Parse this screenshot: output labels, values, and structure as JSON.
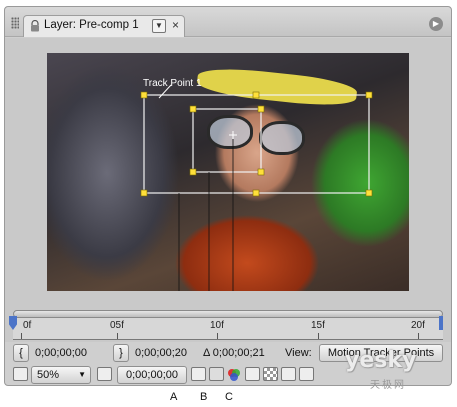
{
  "tab": {
    "title": "Layer: Pre-comp 1",
    "dropdown_glyph": "▼",
    "close_glyph": "×"
  },
  "panel_menu_glyph": "▶",
  "viewer": {
    "track_point_label": "Track Point 1"
  },
  "timeline": {
    "ticks": [
      "0f",
      "05f",
      "10f",
      "15f",
      "20f"
    ]
  },
  "controls": {
    "in_point": "0;00;00;00",
    "out_point": "0;00;00;20",
    "duration": "Δ 0;00;00;21",
    "view_label": "View:",
    "view_value": "Motion Tracker Points",
    "zoom": "50%",
    "zoom_caret": "▼",
    "current_time": "0;00;00;00"
  },
  "callouts": [
    "A",
    "B",
    "C"
  ],
  "watermark": {
    "main": "yesky",
    "sub": "天极网"
  }
}
